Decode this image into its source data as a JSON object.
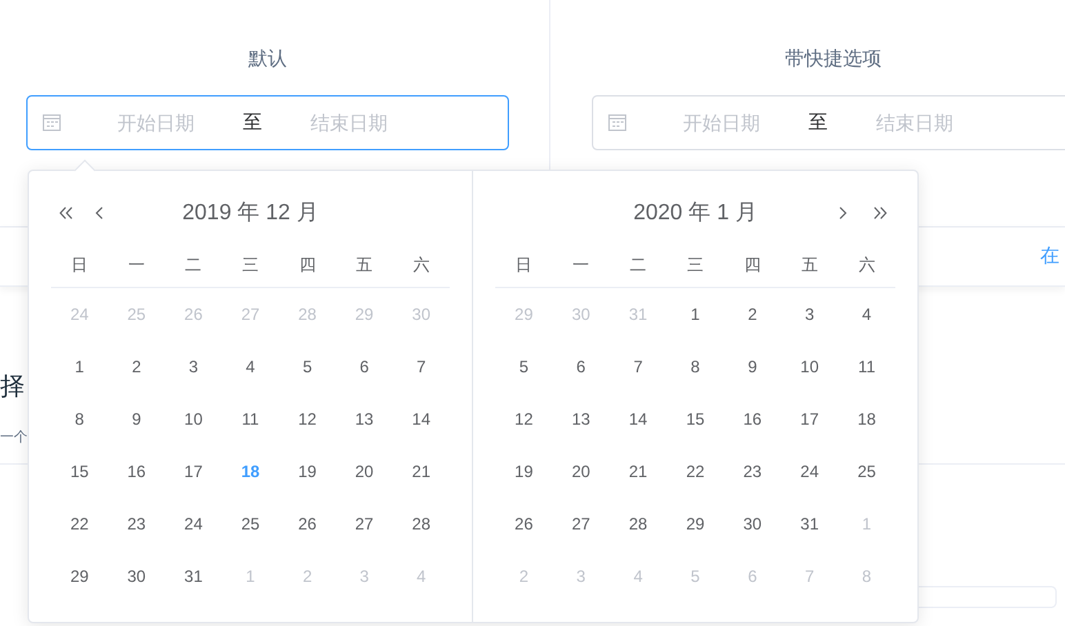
{
  "sections": [
    {
      "title": "默认",
      "start_placeholder": "开始日期",
      "separator": "至",
      "end_placeholder": "结束日期",
      "focused": true
    },
    {
      "title": "带快捷选项",
      "start_placeholder": "开始日期",
      "separator": "至",
      "end_placeholder": "结束日期",
      "focused": false
    }
  ],
  "background": {
    "link": "在",
    "heading": "择",
    "text": "一个"
  },
  "calendars": [
    {
      "title": "2019 年 12 月",
      "weekdays": [
        "日",
        "一",
        "二",
        "三",
        "四",
        "五",
        "六"
      ],
      "prev_arrows": true,
      "next_arrows": false,
      "weeks": [
        [
          {
            "d": "24",
            "other": true,
            "today": false
          },
          {
            "d": "25",
            "other": true,
            "today": false
          },
          {
            "d": "26",
            "other": true,
            "today": false
          },
          {
            "d": "27",
            "other": true,
            "today": false
          },
          {
            "d": "28",
            "other": true,
            "today": false
          },
          {
            "d": "29",
            "other": true,
            "today": false
          },
          {
            "d": "30",
            "other": true,
            "today": false
          }
        ],
        [
          {
            "d": "1",
            "other": false,
            "today": false
          },
          {
            "d": "2",
            "other": false,
            "today": false
          },
          {
            "d": "3",
            "other": false,
            "today": false
          },
          {
            "d": "4",
            "other": false,
            "today": false
          },
          {
            "d": "5",
            "other": false,
            "today": false
          },
          {
            "d": "6",
            "other": false,
            "today": false
          },
          {
            "d": "7",
            "other": false,
            "today": false
          }
        ],
        [
          {
            "d": "8",
            "other": false,
            "today": false
          },
          {
            "d": "9",
            "other": false,
            "today": false
          },
          {
            "d": "10",
            "other": false,
            "today": false
          },
          {
            "d": "11",
            "other": false,
            "today": false
          },
          {
            "d": "12",
            "other": false,
            "today": false
          },
          {
            "d": "13",
            "other": false,
            "today": false
          },
          {
            "d": "14",
            "other": false,
            "today": false
          }
        ],
        [
          {
            "d": "15",
            "other": false,
            "today": false
          },
          {
            "d": "16",
            "other": false,
            "today": false
          },
          {
            "d": "17",
            "other": false,
            "today": false
          },
          {
            "d": "18",
            "other": false,
            "today": true
          },
          {
            "d": "19",
            "other": false,
            "today": false
          },
          {
            "d": "20",
            "other": false,
            "today": false
          },
          {
            "d": "21",
            "other": false,
            "today": false
          }
        ],
        [
          {
            "d": "22",
            "other": false,
            "today": false
          },
          {
            "d": "23",
            "other": false,
            "today": false
          },
          {
            "d": "24",
            "other": false,
            "today": false
          },
          {
            "d": "25",
            "other": false,
            "today": false
          },
          {
            "d": "26",
            "other": false,
            "today": false
          },
          {
            "d": "27",
            "other": false,
            "today": false
          },
          {
            "d": "28",
            "other": false,
            "today": false
          }
        ],
        [
          {
            "d": "29",
            "other": false,
            "today": false
          },
          {
            "d": "30",
            "other": false,
            "today": false
          },
          {
            "d": "31",
            "other": false,
            "today": false
          },
          {
            "d": "1",
            "other": true,
            "today": false
          },
          {
            "d": "2",
            "other": true,
            "today": false
          },
          {
            "d": "3",
            "other": true,
            "today": false
          },
          {
            "d": "4",
            "other": true,
            "today": false
          }
        ]
      ]
    },
    {
      "title": "2020 年 1 月",
      "weekdays": [
        "日",
        "一",
        "二",
        "三",
        "四",
        "五",
        "六"
      ],
      "prev_arrows": false,
      "next_arrows": true,
      "weeks": [
        [
          {
            "d": "29",
            "other": true,
            "today": false
          },
          {
            "d": "30",
            "other": true,
            "today": false
          },
          {
            "d": "31",
            "other": true,
            "today": false
          },
          {
            "d": "1",
            "other": false,
            "today": false
          },
          {
            "d": "2",
            "other": false,
            "today": false
          },
          {
            "d": "3",
            "other": false,
            "today": false
          },
          {
            "d": "4",
            "other": false,
            "today": false
          }
        ],
        [
          {
            "d": "5",
            "other": false,
            "today": false
          },
          {
            "d": "6",
            "other": false,
            "today": false
          },
          {
            "d": "7",
            "other": false,
            "today": false
          },
          {
            "d": "8",
            "other": false,
            "today": false
          },
          {
            "d": "9",
            "other": false,
            "today": false
          },
          {
            "d": "10",
            "other": false,
            "today": false
          },
          {
            "d": "11",
            "other": false,
            "today": false
          }
        ],
        [
          {
            "d": "12",
            "other": false,
            "today": false
          },
          {
            "d": "13",
            "other": false,
            "today": false
          },
          {
            "d": "14",
            "other": false,
            "today": false
          },
          {
            "d": "15",
            "other": false,
            "today": false
          },
          {
            "d": "16",
            "other": false,
            "today": false
          },
          {
            "d": "17",
            "other": false,
            "today": false
          },
          {
            "d": "18",
            "other": false,
            "today": false
          }
        ],
        [
          {
            "d": "19",
            "other": false,
            "today": false
          },
          {
            "d": "20",
            "other": false,
            "today": false
          },
          {
            "d": "21",
            "other": false,
            "today": false
          },
          {
            "d": "22",
            "other": false,
            "today": false
          },
          {
            "d": "23",
            "other": false,
            "today": false
          },
          {
            "d": "24",
            "other": false,
            "today": false
          },
          {
            "d": "25",
            "other": false,
            "today": false
          }
        ],
        [
          {
            "d": "26",
            "other": false,
            "today": false
          },
          {
            "d": "27",
            "other": false,
            "today": false
          },
          {
            "d": "28",
            "other": false,
            "today": false
          },
          {
            "d": "29",
            "other": false,
            "today": false
          },
          {
            "d": "30",
            "other": false,
            "today": false
          },
          {
            "d": "31",
            "other": false,
            "today": false
          },
          {
            "d": "1",
            "other": true,
            "today": false
          }
        ],
        [
          {
            "d": "2",
            "other": true,
            "today": false
          },
          {
            "d": "3",
            "other": true,
            "today": false
          },
          {
            "d": "4",
            "other": true,
            "today": false
          },
          {
            "d": "5",
            "other": true,
            "today": false
          },
          {
            "d": "6",
            "other": true,
            "today": false
          },
          {
            "d": "7",
            "other": true,
            "today": false
          },
          {
            "d": "8",
            "other": true,
            "today": false
          }
        ]
      ]
    }
  ]
}
